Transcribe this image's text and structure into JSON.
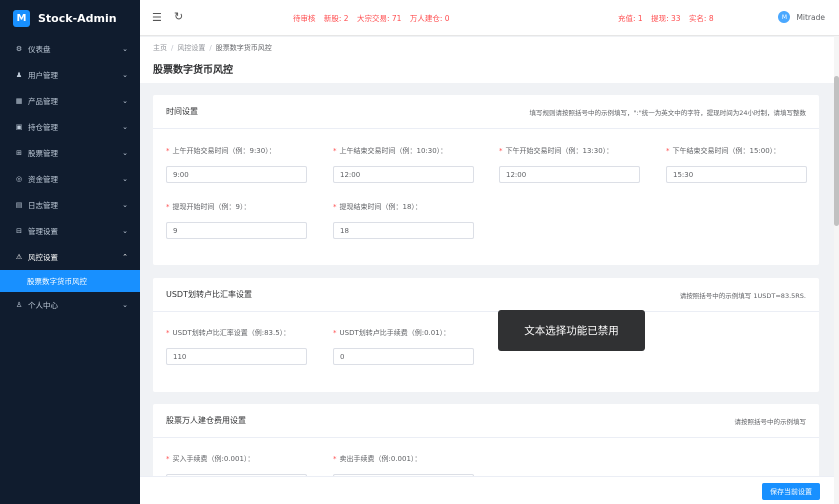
{
  "app": {
    "logo_glyph": "M",
    "title": "Stock-Admin"
  },
  "sidebar": {
    "items": [
      {
        "icon": "dashboard-icon",
        "glyph": "⚙",
        "label": "仪表盘"
      },
      {
        "icon": "user-icon",
        "glyph": "♟",
        "label": "用户管理"
      },
      {
        "icon": "product-icon",
        "glyph": "▦",
        "label": "产品管理"
      },
      {
        "icon": "position-icon",
        "glyph": "▣",
        "label": "持仓管理"
      },
      {
        "icon": "stock-icon",
        "glyph": "⊞",
        "label": "股票管理"
      },
      {
        "icon": "money-icon",
        "glyph": "◎",
        "label": "资金管理"
      },
      {
        "icon": "log-icon",
        "glyph": "▤",
        "label": "日志管理"
      },
      {
        "icon": "settings-icon",
        "glyph": "⊟",
        "label": "管理设置"
      },
      {
        "icon": "warning-icon",
        "glyph": "⚠",
        "label": "风控设置"
      }
    ],
    "active_sub": "股票数字货币风控",
    "last_item": {
      "icon": "person-icon",
      "glyph": "♙",
      "label": "个人中心"
    }
  },
  "topbar": {
    "notices": [
      "待审核",
      "新股: 2",
      "大宗交易: 71",
      "万人建仓: 0"
    ],
    "money": [
      "充值: 1",
      "提现: 33",
      "实名: 8"
    ],
    "user": {
      "avatar": "M",
      "name": "Mitrade"
    }
  },
  "breadcrumb": {
    "home": "主页",
    "parent": "风控设置",
    "current": "股票数字货币风控"
  },
  "page_title": "股票数字货币风控",
  "time_card": {
    "title": "时间设置",
    "hint": "填写规则请按照括号中的示例填写，\":\"统一为英文中的字符，提现时间为24小时制，请填写整数",
    "fields": [
      {
        "label": "上午开始交易时间（例：9:30）：",
        "value": "9:00"
      },
      {
        "label": "上午结束交易时间（例：10:30）：",
        "value": "12:00"
      },
      {
        "label": "下午开始交易时间（例：13:30）：",
        "value": "12:00"
      },
      {
        "label": "下午结束交易时间（例：15:00）：",
        "value": "15:30"
      },
      {
        "label": "提现开始时间（例：9）：",
        "value": "9"
      },
      {
        "label": "提现结束时间（例：18）：",
        "value": "18"
      }
    ]
  },
  "usdt_card": {
    "title": "USDT划转卢比汇率设置",
    "hint": "请按照括号中的示例填写 1USDT=83.5RS.",
    "fields": [
      {
        "label": "USDT划转卢比汇率设置（例:83.5）：",
        "value": "110"
      },
      {
        "label": "USDT划转卢比手续费（例:0.01）：",
        "value": "0"
      }
    ]
  },
  "fee_card": {
    "title": "股票万人建仓费用设置",
    "hint": "请按照括号中的示例填写",
    "fields": [
      {
        "label": "买入手续费（例:0.001）："
      },
      {
        "label": "卖出手续费（例:0.001）："
      }
    ]
  },
  "toast": "文本选择功能已禁用",
  "save_label": "保存当前设置",
  "colors": {
    "sidebar_bg": "#101c2e",
    "accent": "#1890ff",
    "alert": "#ff4d4f"
  }
}
